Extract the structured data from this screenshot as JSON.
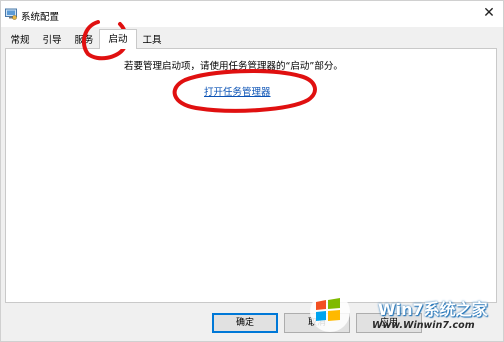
{
  "window": {
    "title": "系统配置"
  },
  "tabs": [
    {
      "label": "常规"
    },
    {
      "label": "引导"
    },
    {
      "label": "服务"
    },
    {
      "label": "启动"
    },
    {
      "label": "工具"
    }
  ],
  "active_tab": "启动",
  "panel": {
    "message": "若要管理启动项，请使用任务管理器的“启动”部分。",
    "link": "打开任务管理器"
  },
  "buttons": {
    "ok": "确定",
    "cancel": "取消",
    "apply": "应用"
  },
  "watermark": {
    "brand": "Win7系统之家",
    "url": "Www.Winwin7.com"
  },
  "colors": {
    "annotation": "#e01010",
    "link": "#0a52b5",
    "accent": "#0078d7"
  }
}
